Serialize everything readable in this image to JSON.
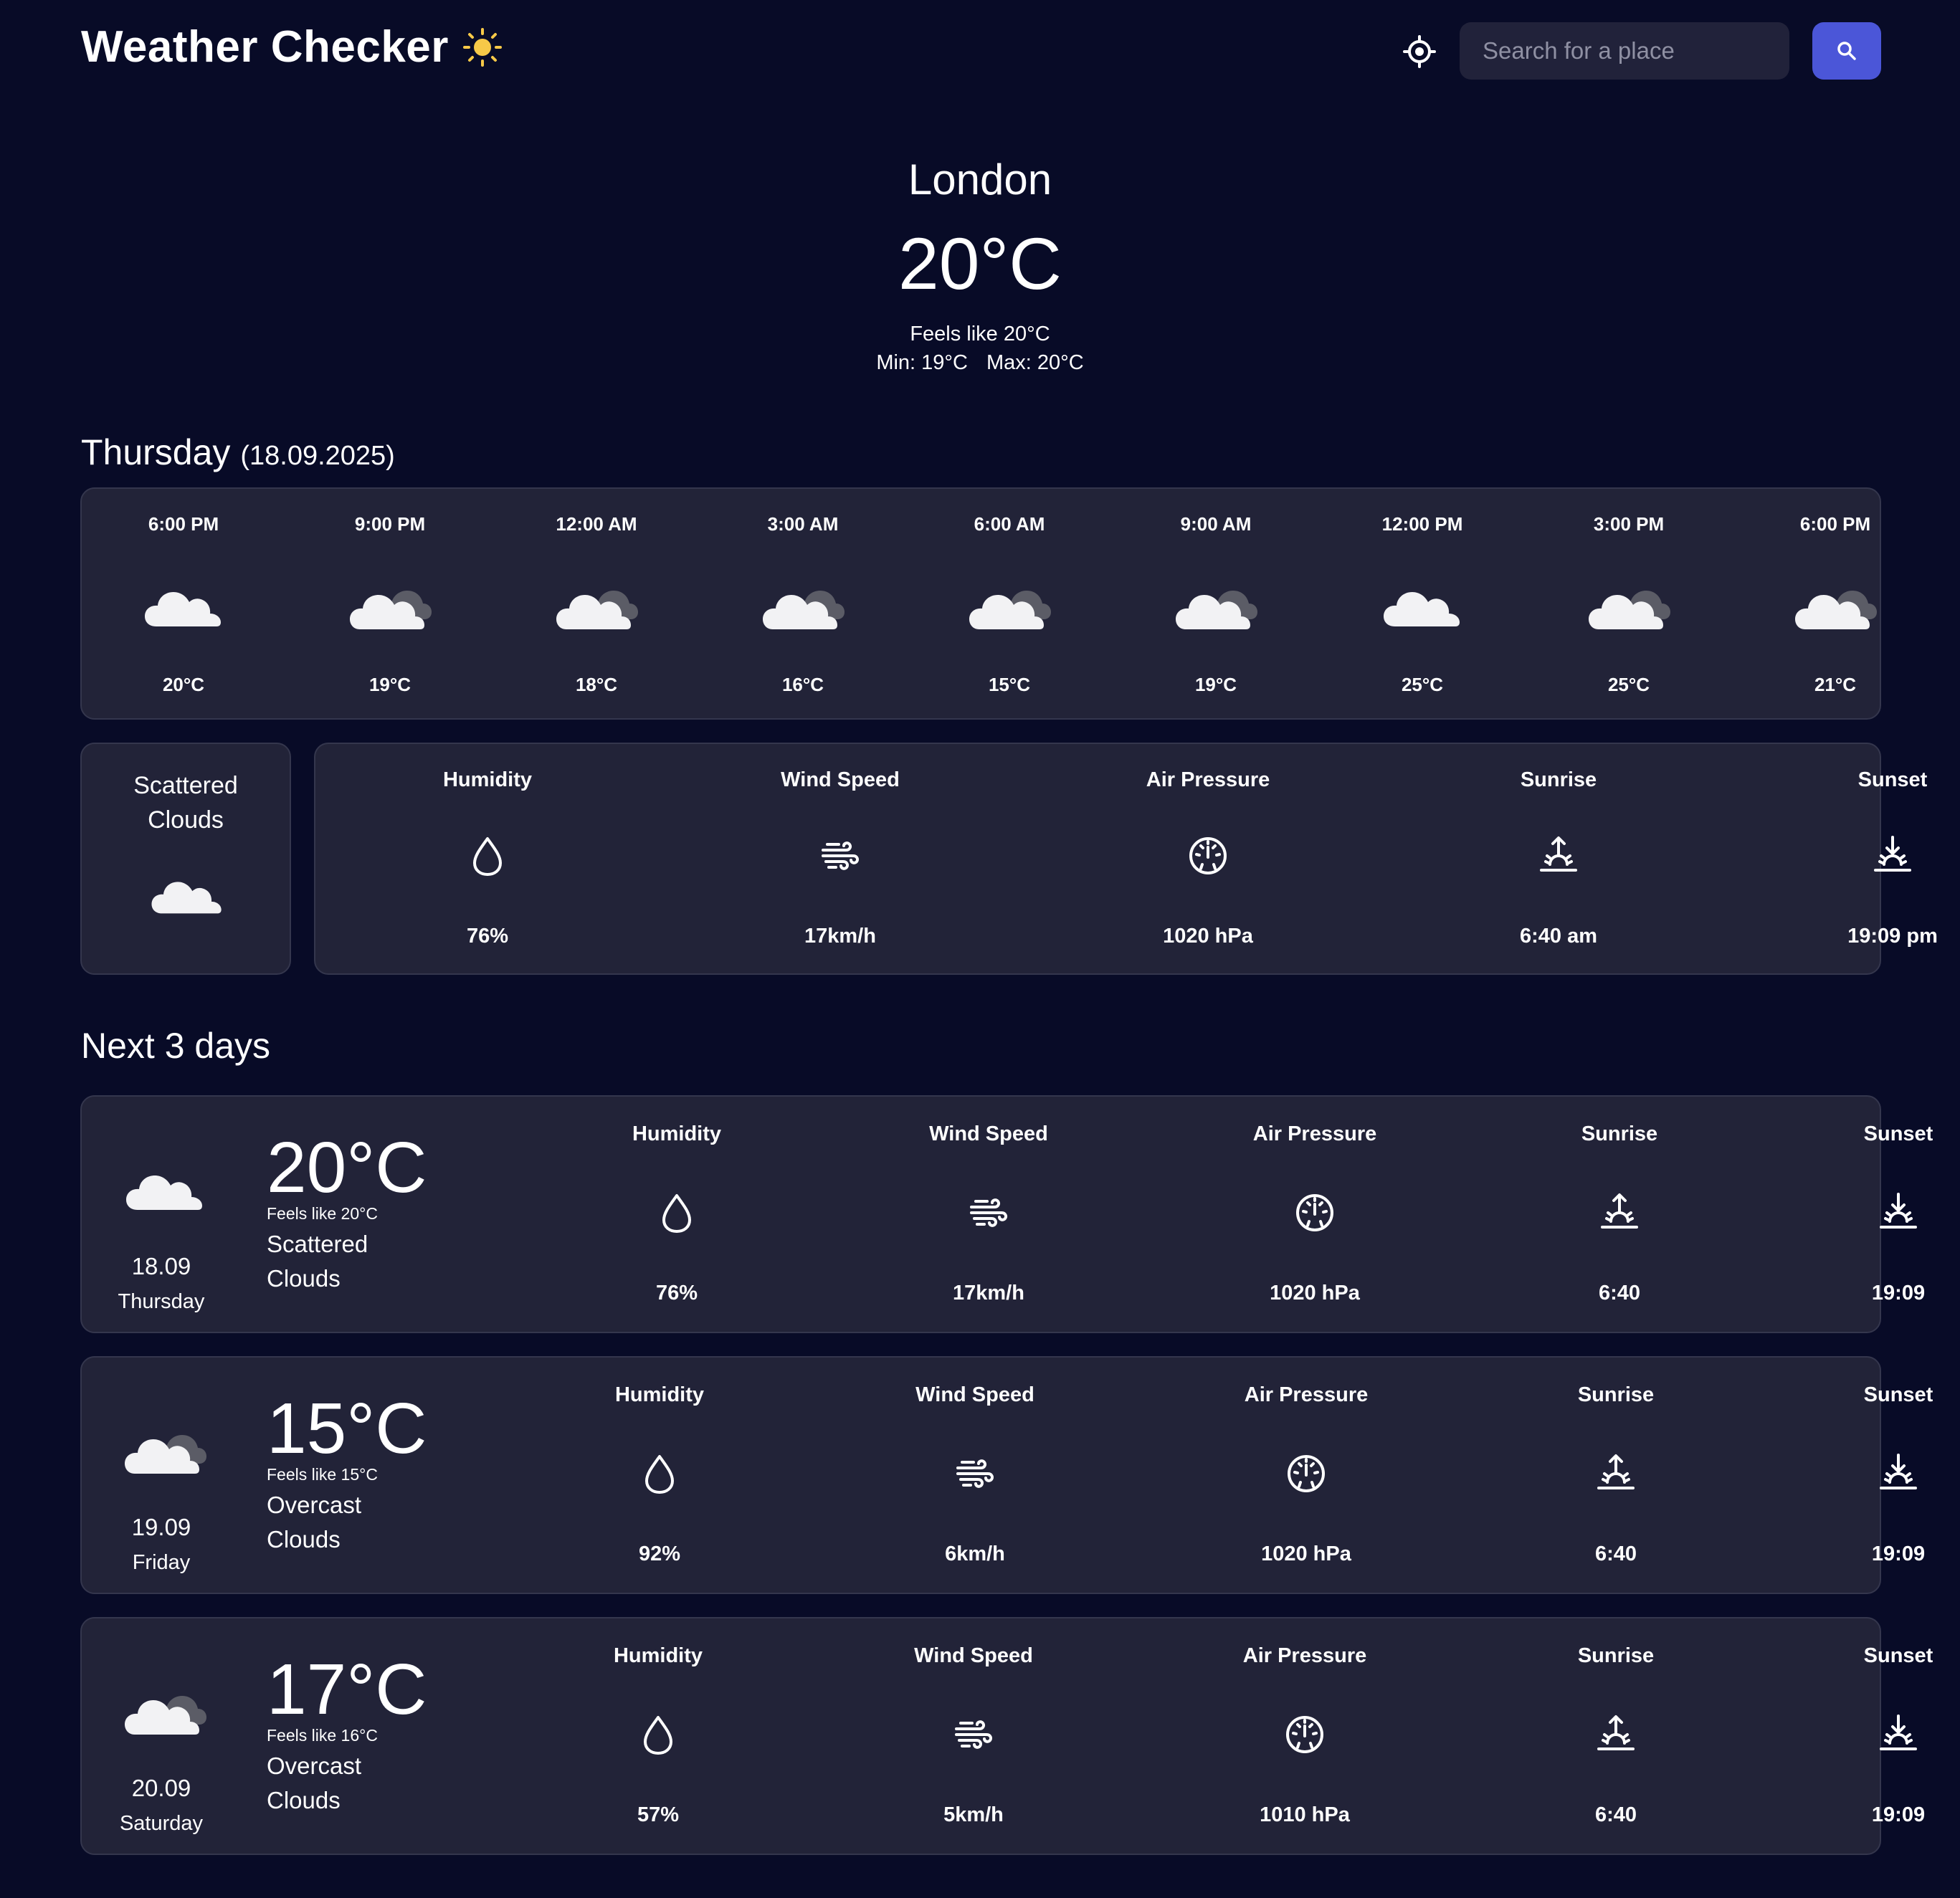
{
  "app": {
    "title": "Weather Checker"
  },
  "search": {
    "placeholder": "Search for a place"
  },
  "current": {
    "city": "London",
    "temp": "20°C",
    "feels": "Feels like 20°C",
    "min": "Min: 19°C",
    "max": "Max: 20°C"
  },
  "today": {
    "day": "Thursday",
    "date": "(18.09.2025)"
  },
  "hourly": [
    {
      "time": "6:00 PM",
      "temp": "20°C",
      "icon": "cloud-icon"
    },
    {
      "time": "9:00 PM",
      "temp": "19°C",
      "icon": "overcast-clouds-icon"
    },
    {
      "time": "12:00 AM",
      "temp": "18°C",
      "icon": "overcast-clouds-icon"
    },
    {
      "time": "3:00 AM",
      "temp": "16°C",
      "icon": "overcast-clouds-icon"
    },
    {
      "time": "6:00 AM",
      "temp": "15°C",
      "icon": "overcast-clouds-icon"
    },
    {
      "time": "9:00 AM",
      "temp": "19°C",
      "icon": "overcast-clouds-icon"
    },
    {
      "time": "12:00 PM",
      "temp": "25°C",
      "icon": "cloud-icon"
    },
    {
      "time": "3:00 PM",
      "temp": "25°C",
      "icon": "overcast-clouds-icon"
    },
    {
      "time": "6:00 PM",
      "temp": "21°C",
      "icon": "overcast-clouds-icon"
    }
  ],
  "condition": {
    "label": "Scattered Clouds",
    "icon": "cloud-icon"
  },
  "details": {
    "humidity_label": "Humidity",
    "humidity": "76%",
    "wind_label": "Wind Speed",
    "wind": "17km/h",
    "pressure_label": "Air Pressure",
    "pressure": "1020 hPa",
    "sunrise_label": "Sunrise",
    "sunrise": "6:40 am",
    "sunset_label": "Sunset",
    "sunset": "19:09 pm"
  },
  "next_heading": "Next 3 days",
  "forecast": [
    {
      "date": "18.09",
      "day": "Thursday",
      "temp": "20°C",
      "feels": "Feels like 20°C",
      "desc": "Scattered Clouds",
      "icon": "cloud-icon",
      "humidity": "76%",
      "wind": "17km/h",
      "pressure": "1020 hPa",
      "sunrise": "6:40",
      "sunset": "19:09"
    },
    {
      "date": "19.09",
      "day": "Friday",
      "temp": "15°C",
      "feels": "Feels like 15°C",
      "desc": "Overcast Clouds",
      "icon": "overcast-clouds-icon",
      "humidity": "92%",
      "wind": "6km/h",
      "pressure": "1020 hPa",
      "sunrise": "6:40",
      "sunset": "19:09"
    },
    {
      "date": "20.09",
      "day": "Saturday",
      "temp": "17°C",
      "feels": "Feels like 16°C",
      "desc": "Overcast Clouds",
      "icon": "overcast-clouds-icon",
      "humidity": "57%",
      "wind": "5km/h",
      "pressure": "1010 hPa",
      "sunrise": "6:40",
      "sunset": "19:09"
    }
  ],
  "colors": {
    "background": "#080b27",
    "card": "#222338",
    "accent": "#4b56d8",
    "sun": "#f7c948"
  }
}
